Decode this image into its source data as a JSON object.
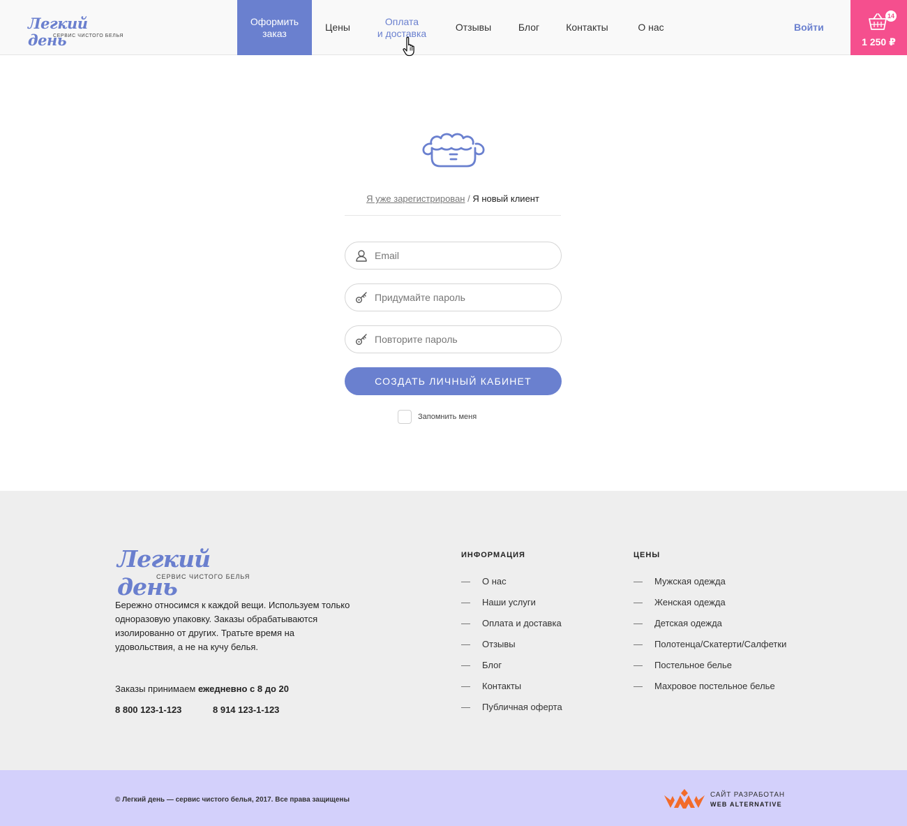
{
  "header": {
    "logo_title": "Легкий день",
    "logo_subtitle": "сервис чистого белья",
    "nav": [
      {
        "label": "Оформить\nзаказ",
        "state": "active"
      },
      {
        "label": "Цены",
        "state": "normal"
      },
      {
        "label": "Оплата\nи доставка",
        "state": "hover"
      },
      {
        "label": "Отзывы",
        "state": "normal"
      },
      {
        "label": "Блог",
        "state": "normal"
      },
      {
        "label": "Контакты",
        "state": "normal"
      },
      {
        "label": "О нас",
        "state": "normal"
      }
    ],
    "login": "Войти",
    "cart": {
      "count": "14",
      "total": "1 250 ₽",
      "icon": "basket-icon"
    }
  },
  "auth": {
    "icon": "laundry-basin-icon",
    "tab_registered": "Я уже зарегистрирован",
    "separator": "/",
    "tab_new": "Я новый клиент",
    "fields": [
      {
        "icon": "user-icon",
        "placeholder": "Email",
        "value": ""
      },
      {
        "icon": "key-icon",
        "placeholder": "Придумайте пароль",
        "value": ""
      },
      {
        "icon": "key-icon",
        "placeholder": "Повторите пароль",
        "value": ""
      }
    ],
    "submit": "СОЗДАТЬ ЛИЧНЫЙ КАБИНЕТ",
    "remember": "Запомнить меня",
    "remember_checked": false
  },
  "footer": {
    "logo_title": "Легкий день",
    "logo_subtitle": "сервис чистого белья",
    "about": "Бережно относимся к каждой вещи. Используем только одноразовую упаковку.  Заказы обрабатываются изолированно от других. Тратьте время на удовольствия, а не на кучу белья.",
    "hours_prefix": "Заказы  принимаем ",
    "hours_bold": "ежедневно с 8 до 20",
    "phones": [
      "8 800 123-1-123",
      "8 914  123-1-123"
    ],
    "info_title": "ИНФОРМАЦИЯ",
    "info_links": [
      "О нас",
      "Наши услуги",
      "Оплата и доставка",
      "Отзывы",
      "Блог",
      "Контакты",
      "Публичная оферта"
    ],
    "prices_title": "ЦЕНЫ",
    "price_links": [
      "Мужская одежда",
      "Женская одежда",
      "Детская одежда",
      "Полотенца/Скатерти/Салфетки",
      "Постельное белье",
      "Махровое постельное белье"
    ],
    "dash": "—"
  },
  "bottom": {
    "copyright": "© Легкий день — сервис чистого белья, 2017. Все права защищены",
    "dev_line1": "САЙТ РАЗРАБОТАН",
    "dev_line2": "WEB ALTERNATIVE"
  },
  "colors": {
    "accent": "#6a80cf",
    "cart": "#f54f8e",
    "footer_bg": "#eeeeee",
    "bottom_bg": "#d3d0fb",
    "dev_logo": "#f26b2a"
  }
}
